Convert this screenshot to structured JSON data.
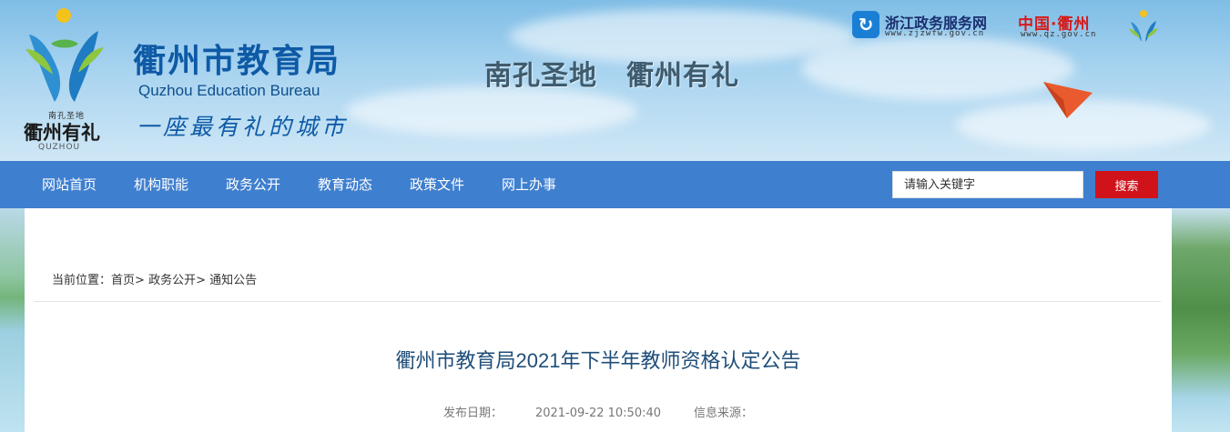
{
  "header": {
    "logo": {
      "small_top": "南孔圣地",
      "name": "衢州有礼",
      "sub": "QUZHOU"
    },
    "title": "衢州市教育局",
    "title_en": "Quzhou Education Bureau",
    "slogan": "一座最有礼的城市",
    "center_slogan_1": "南孔圣地",
    "center_slogan_2": "衢州有礼",
    "zjzwfw": {
      "name": "浙江政务服务网",
      "url": "www.zjzwfw.gov.cn"
    },
    "qz": {
      "name": "中国·衢州",
      "url": "www.qz.gov.cn"
    }
  },
  "nav": {
    "items": [
      {
        "label": "网站首页"
      },
      {
        "label": "机构职能"
      },
      {
        "label": "政务公开"
      },
      {
        "label": "教育动态"
      },
      {
        "label": "政策文件"
      },
      {
        "label": "网上办事"
      }
    ],
    "search": {
      "placeholder": "请输入关键字",
      "button": "搜索"
    }
  },
  "breadcrumb": {
    "prefix": "当前位置：",
    "items": [
      "首页",
      "政务公开",
      "通知公告"
    ],
    "sep": ">"
  },
  "article": {
    "title": "衢州市教育局2021年下半年教师资格认定公告",
    "publish_label": "发布日期：",
    "publish_date": "2021-09-22 10:50:40",
    "source_label": "信息来源："
  },
  "colors": {
    "nav_bg": "#3f7fcf",
    "search_button": "#d0121b",
    "title_blue": "#0e5aa6"
  }
}
